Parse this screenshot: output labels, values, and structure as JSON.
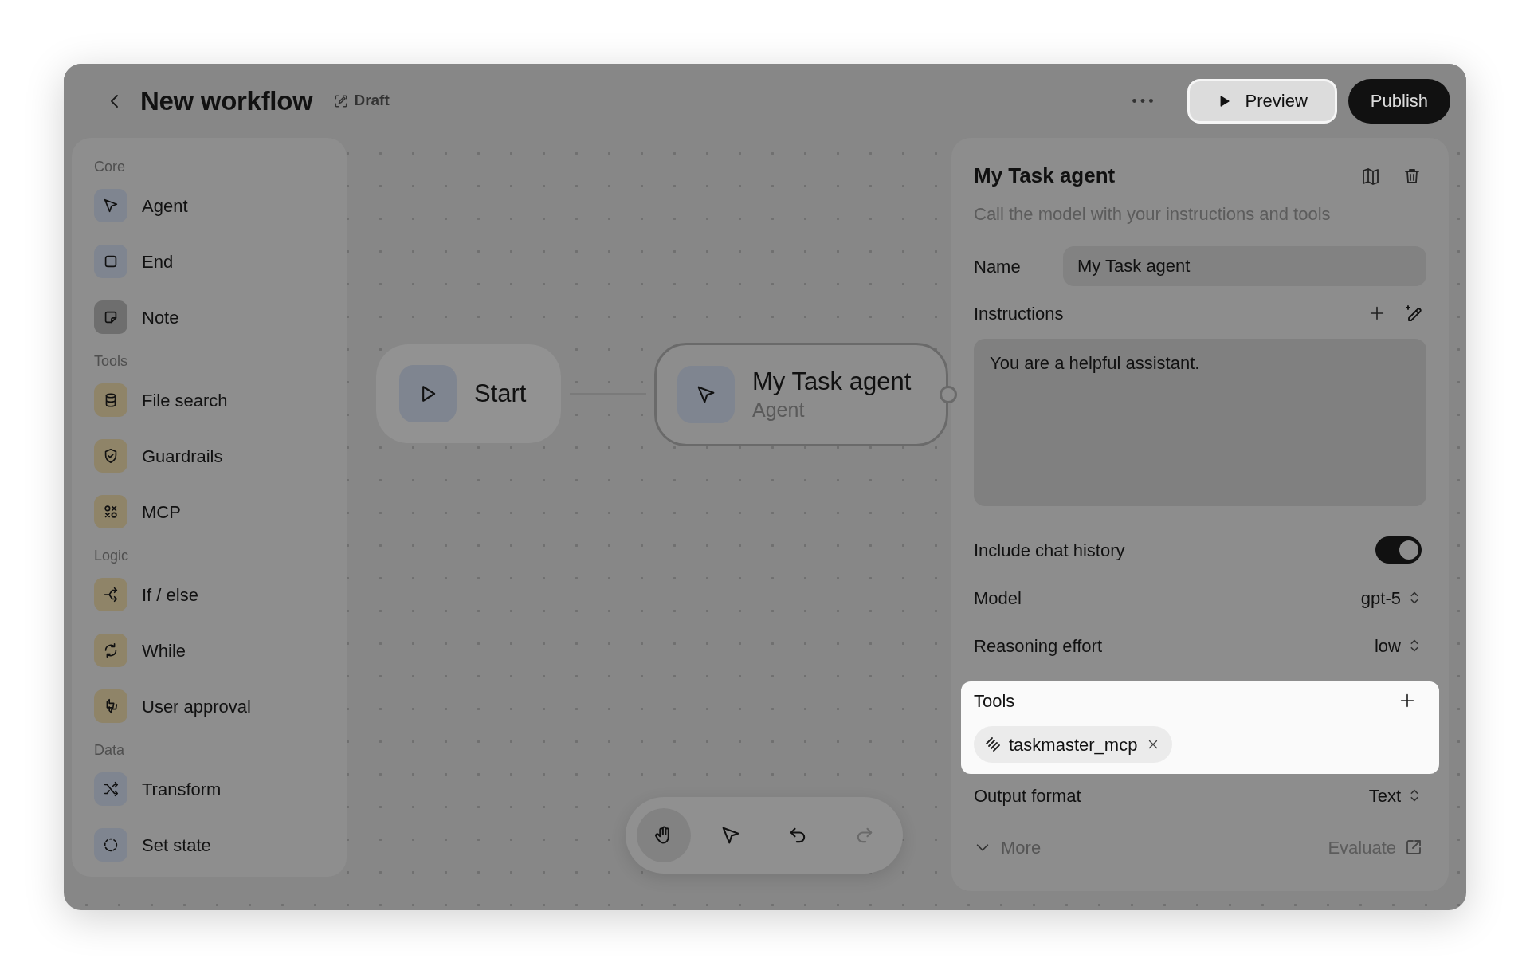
{
  "header": {
    "title": "New workflow",
    "status": "Draft",
    "actions": [
      {
        "label": "Preview",
        "kind": "preview",
        "highlighted": true
      },
      {
        "label": "Publish",
        "kind": "publish",
        "highlighted": false
      }
    ]
  },
  "sidebar": {
    "sections": [
      {
        "title": "Core",
        "items": [
          {
            "label": "Agent",
            "color": "#7f8590"
          },
          {
            "label": "End",
            "color": "#7f8590"
          },
          {
            "label": "Note",
            "color": "#6e6e6e"
          }
        ]
      },
      {
        "title": "Tools",
        "items": [
          {
            "label": "File search",
            "color": "#8f8468"
          },
          {
            "label": "Guardrails",
            "color": "#8f8468"
          },
          {
            "label": "MCP",
            "color": "#8f8468"
          }
        ]
      },
      {
        "title": "Logic",
        "items": [
          {
            "label": "If / else",
            "color": "#8f8468"
          },
          {
            "label": "While",
            "color": "#8f8468"
          },
          {
            "label": "User approval",
            "color": "#8f8468"
          }
        ]
      },
      {
        "title": "Data",
        "items": [
          {
            "label": "Transform",
            "color": "#7f8590"
          },
          {
            "label": "Set state",
            "color": "#7f8590"
          }
        ]
      }
    ]
  },
  "canvas": {
    "nodes": [
      {
        "kind": "start",
        "title": "Start",
        "selected": false
      },
      {
        "kind": "agent",
        "title": "My Task agent",
        "subtitle": "Agent",
        "selected": true
      }
    ],
    "toolbar": [
      {
        "kind": "hand",
        "selected": true,
        "disabled": false
      },
      {
        "kind": "pointer",
        "selected": false,
        "disabled": false
      },
      {
        "kind": "undo",
        "selected": false,
        "disabled": false
      },
      {
        "kind": "redo",
        "selected": false,
        "disabled": true
      }
    ]
  },
  "inspector": {
    "title": "My Task agent",
    "subtitle": "Call the model with your instructions and tools",
    "name": {
      "label": "Name",
      "value": "My Task agent"
    },
    "instructions": {
      "label": "Instructions",
      "value": "You are a helpful assistant."
    },
    "chat_history": {
      "label": "Include chat history",
      "on": true
    },
    "selects": [
      {
        "label": "Model",
        "value": "gpt-5"
      },
      {
        "label": "Reasoning effort",
        "value": "low"
      }
    ],
    "tools": {
      "label": "Tools",
      "highlighted": true,
      "chips": [
        {
          "label": "taskmaster_mcp"
        }
      ]
    },
    "output_format": {
      "label": "Output format",
      "value": "Text"
    },
    "more": {
      "label": "More",
      "expanded": false
    },
    "evaluate": {
      "label": "Evaluate"
    }
  }
}
